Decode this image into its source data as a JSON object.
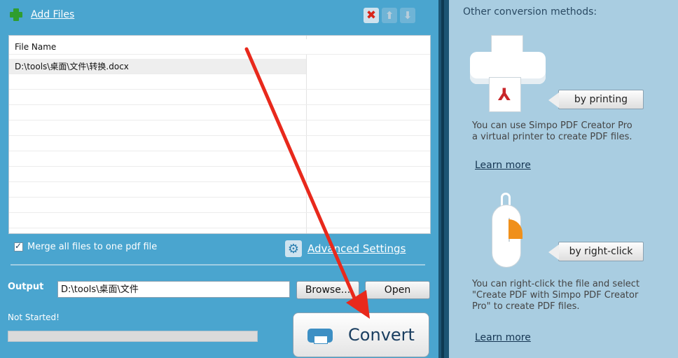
{
  "left": {
    "add_files": "Add Files",
    "table": {
      "header": "File Name",
      "rows": [
        "D:\\tools\\桌面\\文件\\转换.docx"
      ]
    },
    "merge_label": "Merge all files to one pdf file",
    "advanced_settings": "Advanced Settings",
    "output_label": "Output",
    "output_value": "D:\\tools\\桌面\\文件",
    "browse_label": "Browse...",
    "open_label": "Open",
    "status": "Not Started!",
    "progress": 0,
    "convert_label": "Convert"
  },
  "right": {
    "title": "Other conversion methods:",
    "by_printing": "by printing",
    "printing_text": "You can use Simpo PDF Creator Pro\na virtual printer to create PDF files.",
    "learn_more_1": "Learn more",
    "by_right_click": "by right-click",
    "rightclick_text": "You can right-click the file and select\n\"Create PDF with Simpo PDF Creator\nPro\" to create PDF files.",
    "learn_more_2": "Learn more"
  },
  "colors": {
    "left_bg": "#4aa5cf",
    "right_bg": "#a9cde1",
    "accent_arrow": "#e8291c"
  },
  "icons": [
    "plus-icon",
    "delete-icon",
    "arrow-up-icon",
    "arrow-down-icon",
    "gear-icon",
    "printer-icon",
    "pdf-icon",
    "mouse-icon"
  ]
}
